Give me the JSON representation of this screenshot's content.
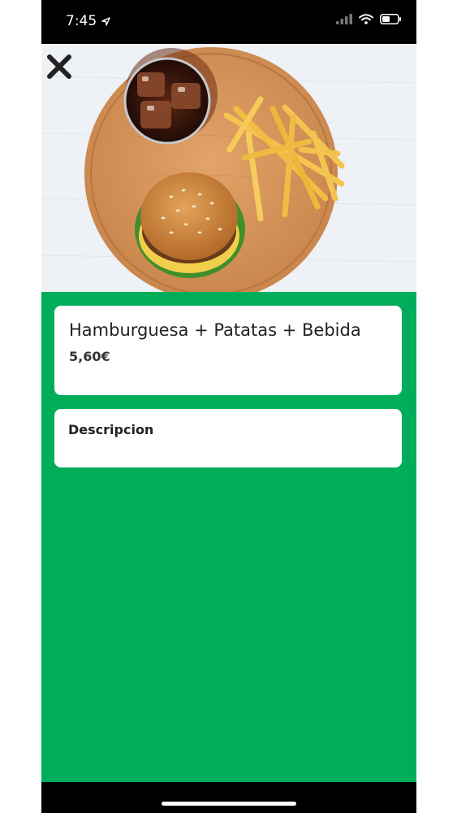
{
  "status_bar": {
    "time": "7:45",
    "location_icon": "location-arrow-icon",
    "signal_icon": "cellular-signal-icon",
    "wifi_icon": "wifi-icon",
    "battery_icon": "battery-icon"
  },
  "hero": {
    "image_subject": "burger-fries-drink-photo",
    "close_icon": "close-icon"
  },
  "product": {
    "name": "Hamburguesa + Patatas + Bebida",
    "price": "5,60€"
  },
  "description": {
    "heading": "Descripcion"
  },
  "colors": {
    "accent": "#00ad5b",
    "card": "#ffffff",
    "bars": "#000000"
  }
}
